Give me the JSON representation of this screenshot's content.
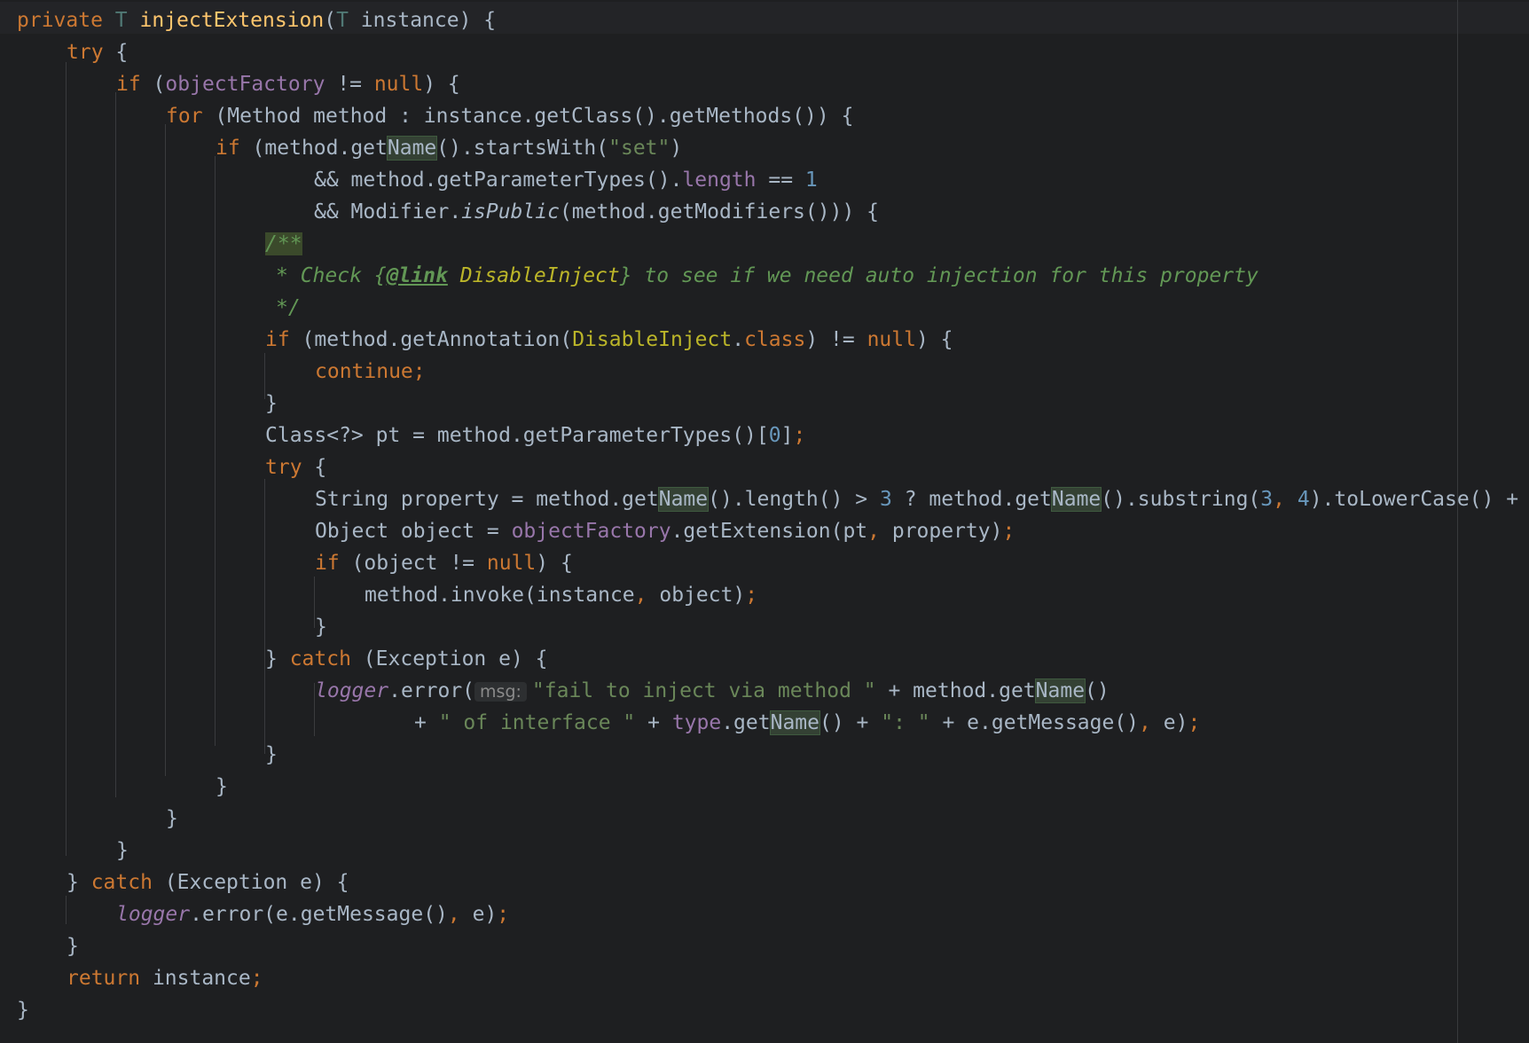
{
  "editor": {
    "code": {
      "signature": {
        "private": "private",
        "T1": "T",
        "method": "injectExtension",
        "paren_open": "(",
        "T2": "T",
        "param": " instance) {"
      },
      "try1": {
        "kw": "try",
        "rest": " {"
      },
      "if1": {
        "kw": "if",
        "p1": " (",
        "field": "objectFactory",
        "p2": " != ",
        "null": "null",
        "p3": ") {"
      },
      "for1": {
        "kw": "for",
        "rest": " (Method method : instance.getClass().getMethods()) {"
      },
      "if2": {
        "kw": "if",
        "p1": " (method.get",
        "name": "Name",
        "p2": "().startsWith(",
        "str": "\"set\"",
        "p3": ")"
      },
      "cond1": {
        "p1": "&& method.getParameterTypes().",
        "field": "length",
        "p2": " == ",
        "num": "1"
      },
      "cond2": {
        "p1": "&& Modifier.",
        "it": "isPublic",
        "p2": "(method.getModifiers())) {"
      },
      "doc1": "/**",
      "doc2": {
        "a": "* Check {",
        "link": "@link",
        "b": " ",
        "cls": "DisableInject",
        "c": "} to see if we need auto injection for this property"
      },
      "doc3": "*/",
      "if3": {
        "kw": "if",
        "p1": " (method.getAnnotation(",
        "cls": "DisableInject",
        "dot": ".",
        "class_kw": "class",
        "p2": ") != ",
        "null": "null",
        "p3": ") {"
      },
      "continue": {
        "kw": "continue",
        "semi": ";"
      },
      "close_if3": "}",
      "classpt": {
        "p1": "Class<?> pt = method.getParameterTypes()[",
        "num": "0",
        "p2": "]",
        "semi": ";"
      },
      "try2": {
        "kw": "try",
        "rest": " {"
      },
      "prop": {
        "p1": "String property = method.get",
        "n1": "Name",
        "p2": "().length() > ",
        "num1": "3",
        "p3": " ? method.get",
        "n2": "Name",
        "p4": "().substring(",
        "num2": "3",
        "comma": ", ",
        "num3": "4",
        "p5": ").toLowerCase() +"
      },
      "obj": {
        "p1": "Object object = ",
        "field": "objectFactory",
        "p2": ".getExtension(pt",
        "comma": ", ",
        "p3": "property)",
        "semi": ";"
      },
      "if4": {
        "kw": "if",
        "p1": " (object != ",
        "null": "null",
        "p2": ") {"
      },
      "invoke": {
        "p1": "method.invoke(instance",
        "comma": ", ",
        "p2": "object)",
        "semi": ";"
      },
      "close_if4": "}",
      "catch1": {
        "p1": "} ",
        "kw": "catch",
        "p2": " (Exception e) {"
      },
      "logger1": {
        "logger": "logger",
        "p1": ".error(",
        "hint": "msg:",
        "str": "\"fail to inject via method \"",
        "p2": " + method.get",
        "name": "Name",
        "p3": "()"
      },
      "logger1b": {
        "p1": "+ ",
        "s1": "\" of interface \"",
        "p2": " + ",
        "field": "type",
        "p3": ".get",
        "name": "Name",
        "p4": "() + ",
        "s2": "\": \"",
        "p5": " + e.getMessage()",
        "comma": ", ",
        "p6": "e)",
        "semi": ";"
      },
      "close_try2": "}",
      "close_if2": "}",
      "close_for": "}",
      "close_if1": "}",
      "catch2": {
        "p1": "} ",
        "kw": "catch",
        "p2": " (Exception e) {"
      },
      "logger2": {
        "logger": "logger",
        "p1": ".error(e.getMessage()",
        "comma": ", ",
        "p2": "e)",
        "semi": ";"
      },
      "close_try1": "}",
      "ret": {
        "kw": "return",
        "p1": " instance",
        "semi": ";"
      },
      "close_method": "}"
    }
  }
}
